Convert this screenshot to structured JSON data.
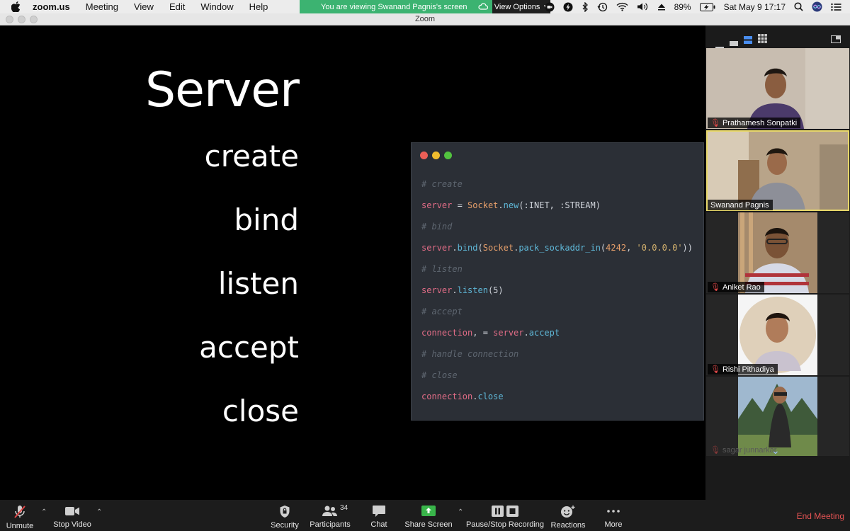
{
  "menubar": {
    "app_name": "zoom.us",
    "menus": [
      "Meeting",
      "View",
      "Edit",
      "Window",
      "Help"
    ],
    "share_banner": "You are viewing Swanand Pagnis's screen",
    "view_options": "View Options",
    "battery": "89%",
    "clock": "Sat May 9  17:17"
  },
  "window": {
    "title": "Zoom"
  },
  "slide": {
    "title": "Server",
    "steps": [
      "create",
      "bind",
      "listen",
      "accept",
      "close"
    ]
  },
  "code": {
    "c_create": "# create",
    "l1_var": "server",
    "l1_eq": " = ",
    "l1_cls": "Socket",
    "l1_dot": ".",
    "l1_meth": "new",
    "l1_args": "(:INET, :STREAM)",
    "c_bind": "# bind",
    "l2_var": "server",
    "l2_dot": ".",
    "l2_meth": "bind",
    "l2_p1": "(",
    "l2_cls": "Socket",
    "l2_dot2": ".",
    "l2_meth2": "pack_sockaddr_in",
    "l2_p2": "(",
    "l2_num": "4242",
    "l2_comma": ", ",
    "l2_str": "'0.0.0.0'",
    "l2_close": "))",
    "c_listen": "# listen",
    "l3_var": "server",
    "l3_dot": ".",
    "l3_meth": "listen",
    "l3_args": "(5)",
    "c_accept": "# accept",
    "l4_var": "connection",
    "l4_eq": ", = ",
    "l4_var2": "server",
    "l4_dot": ".",
    "l4_meth": "accept",
    "c_handle": "# handle connection",
    "c_close": "# close",
    "l5_var": "connection",
    "l5_dot": ".",
    "l5_meth": "close"
  },
  "participants": [
    {
      "name": "Prathamesh Sonpatki",
      "muted": true,
      "active": false
    },
    {
      "name": "Swanand Pagnis",
      "muted": false,
      "active": true
    },
    {
      "name": "Aniket Rao",
      "muted": true,
      "active": false
    },
    {
      "name": "Rishi Pithadiya",
      "muted": true,
      "active": false
    },
    {
      "name": "sagar junnarkar",
      "muted": true,
      "active": false
    }
  ],
  "toolbar": {
    "unmute": "Unmute",
    "stop_video": "Stop Video",
    "security": "Security",
    "participants": "Participants",
    "participant_count": "34",
    "chat": "Chat",
    "share_screen": "Share Screen",
    "recording": "Pause/Stop Recording",
    "reactions": "Reactions",
    "more": "More",
    "end_meeting": "End Meeting"
  },
  "colors": {
    "share_banner": "#3cb371",
    "active_speaker_border": "#e8d86a",
    "end_meeting": "#e55353",
    "code_bg": "#2b2f36"
  }
}
